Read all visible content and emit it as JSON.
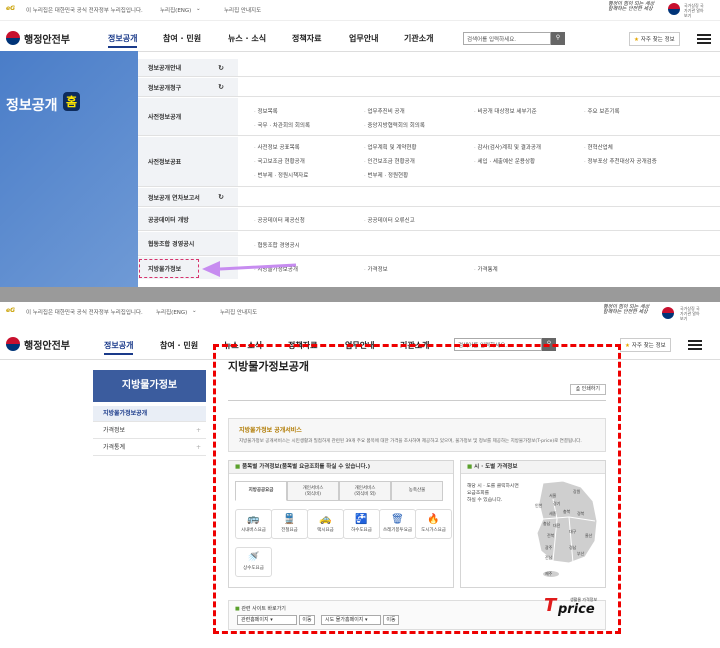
{
  "util": {
    "notice": "이 누리집은 대한민국 공식 전자정부 누리집입니다.",
    "lang": "누리집(ENG)",
    "sitemap": "누리집 안내지도"
  },
  "header": {
    "brand": "행정안전부",
    "nav": [
      "정보공개",
      "참여 · 민원",
      "뉴스 · 소식",
      "정책자료",
      "업무안내",
      "기관소개"
    ],
    "search_placeholder": "검색어를 입력하세요.",
    "favorites": "자주 찾는 정보",
    "slogan": "행정이 힘이 되는 세상 함께하는 안전한 세상",
    "ministry_note": "국가상징 국가기관 알아보기",
    "search_icon": "search-icon",
    "star_icon": "star-icon"
  },
  "top": {
    "hero": {
      "title": "정보공개",
      "home": "홈",
      "color": "#4a7dc8"
    },
    "menu": [
      {
        "label": "정보공개안내",
        "link": true,
        "items": []
      },
      {
        "label": "정보공개청구",
        "link": true,
        "items": []
      },
      {
        "label": "사전정보공개",
        "link": false,
        "items": [
          "정보목록",
          "업무추진비 공개",
          "비공개 대상정보 세부기준",
          "주요 보존기록",
          "국무 · 차관회의 회의록",
          "중앙지방협력회의 회의록"
        ]
      },
      {
        "label": "사전정보공표",
        "link": false,
        "items": [
          "사전정보 공표목록",
          "업무계획 및 계약현황",
          "감사(검사)계획 및 결과공개",
          "현혁산업체",
          "국고보조금 현황공개",
          "인건보조금 현황공개",
          "세입 · 세출예산 운용상황",
          "정부포상 추천대상자 공개검증",
          "번부제 · 정원시책자료",
          "번부제 · 정원현황"
        ]
      },
      {
        "label": "정보공개 연차보고서",
        "link": true,
        "items": []
      },
      {
        "label": "공공데이터 개방",
        "link": false,
        "items": [
          "공공데이터 제공신청",
          "공공데이터 오류신고"
        ]
      },
      {
        "label": "협동조합 경영공시",
        "link": false,
        "items": [
          "협동조합 경영공시"
        ]
      },
      {
        "label": "지방물가정보",
        "link": false,
        "items": [
          "지방물가정보공개",
          "가격정보",
          "가격통계"
        ]
      }
    ],
    "highlight_color": "#d6336c",
    "arrow_color": "#c78cf0"
  },
  "bottom": {
    "side": {
      "title": "지방물가정보",
      "items": [
        {
          "label": "지방물가정보공개",
          "active": true
        },
        {
          "label": "가격정보",
          "active": false
        },
        {
          "label": "가격통계",
          "active": false
        }
      ]
    },
    "page": {
      "title": "지방물가정보공개",
      "print": "인쇄하기",
      "intro_title": "지방물가정보 공개서비스",
      "intro_desc": "지방물가정보 공개서비스는 시민생활과 밀접하게 관련된 39개 주요 품목에 대한 가격을 조사하여 제공하고 있으며, 물가정보 및 정보를 제공하는 지방물가정보(T-price)로 연결됩니다.",
      "item_box_title": "품목별 가격정보",
      "item_box_note": "(품목별 요금조회를 하실 수 있습니다.)",
      "tabs": [
        {
          "l1": "지방공공요금",
          "l2": ""
        },
        {
          "l1": "개인서비스",
          "l2": "(외식비)"
        },
        {
          "l1": "개인서비스",
          "l2": "(외식비 외)"
        },
        {
          "l1": "농축산물",
          "l2": ""
        }
      ],
      "icons": [
        {
          "name": "시내버스요금",
          "icon": "bus-icon",
          "g": "🚌"
        },
        {
          "name": "전철요금",
          "icon": "train-icon",
          "g": "🚆"
        },
        {
          "name": "택시요금",
          "icon": "taxi-icon",
          "g": "🚕"
        },
        {
          "name": "하수도요금",
          "icon": "sewer-icon",
          "g": "🚰"
        },
        {
          "name": "쓰레기봉투요금",
          "icon": "trash-bag-icon",
          "g": "🗑"
        },
        {
          "name": "도시가스요금",
          "icon": "gas-icon",
          "g": "🔥"
        },
        {
          "name": "상수도요금",
          "icon": "water-tap-icon",
          "g": "🚿"
        }
      ],
      "region_box_title": "시 · 도별 가격정보",
      "region_desc": [
        "해당 시 · 도를 클릭하시면",
        "요금조회를",
        "하실 수 있습니다."
      ],
      "regions": [
        "서울",
        "인천",
        "경기",
        "강원",
        "충북",
        "세종",
        "충남",
        "대전",
        "경북",
        "대구",
        "전북",
        "울산",
        "경남",
        "광주",
        "부산",
        "전남",
        "제주"
      ],
      "related_title": "관련 사이트 바로가기",
      "sel1": "관련홈페이지",
      "sel2": "시도 물가홈페이지",
      "go": "이동",
      "tprice_small": "생활물 가격정보",
      "tprice": "price",
      "tprice_t": "T",
      "frame_color": "#e00000"
    }
  }
}
